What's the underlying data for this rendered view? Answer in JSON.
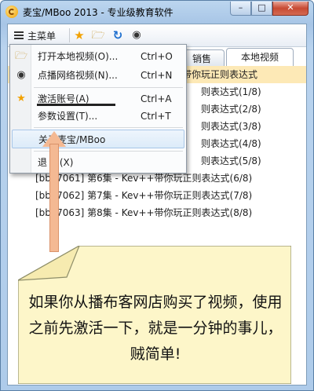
{
  "window": {
    "title": "麦宝/MBoo 2013 - 专业级教育软件",
    "minimize_glyph": "–",
    "maximize_glyph": "□",
    "close_glyph": "✕"
  },
  "toolbar": {
    "menu_label": "主菜单",
    "icons": [
      "star-icon",
      "folder-open-icon",
      "refresh-icon",
      "eye-icon"
    ]
  },
  "tabs": [
    {
      "label": "销售",
      "active": false
    },
    {
      "label": "本地视频",
      "active": true
    }
  ],
  "list": {
    "rows": [
      {
        "text": "带你玩正则表达式",
        "selected": true
      },
      {
        "text": "则表达式(1/8)"
      },
      {
        "text": "则表达式(2/8)"
      },
      {
        "text": "则表达式(3/8)"
      },
      {
        "text": "则表达式(4/8)"
      },
      {
        "text": "则表达式(5/8)"
      },
      {
        "text": "[bbl 7061] 第6集 - Kev++带你玩正则表达式(6/8)"
      },
      {
        "text": "[bbl 7062] 第7集 - Kev++带你玩正则表达式(7/8)"
      },
      {
        "text": "[bbl 7063] 第8集 - Kev++带你玩正则表达式(8/8)"
      }
    ]
  },
  "menu": {
    "items": [
      {
        "label": "打开本地视频(O)...",
        "shortcut": "Ctrl+O",
        "icon": "folder-icon"
      },
      {
        "label": "点播网络视频(N)...",
        "shortcut": "Ctrl+N",
        "icon": "eye-icon"
      },
      {
        "label": "激活账号(A)",
        "shortcut": "Ctrl+A",
        "icon": "star-icon"
      },
      {
        "label": "参数设置(T)...",
        "shortcut": "Ctrl+T",
        "icon": ""
      },
      {
        "label": "关于麦宝/MBoo",
        "shortcut": "",
        "icon": ""
      },
      {
        "label": "退 出(X)",
        "shortcut": "",
        "icon": ""
      }
    ]
  },
  "note": {
    "text": "如果你从播布客网店购买了视频，使用之前先激活一下，就是一分钟的事儿，贼简单!"
  },
  "colors": {
    "accent_selection": "#fde9b6",
    "note_fill": "#fdf6c9",
    "arrow_fill": "#f4b993",
    "close_button": "#c74a33"
  }
}
